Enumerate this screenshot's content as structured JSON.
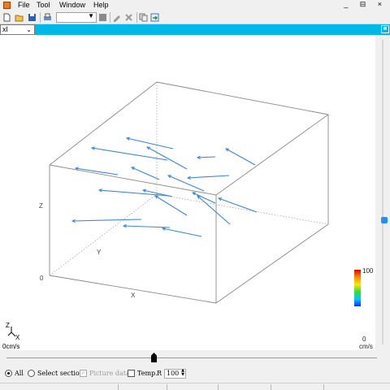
{
  "menu": {
    "items": [
      "File",
      "Tool",
      "Window",
      "Help"
    ]
  },
  "toolbar": {
    "combo_value": ""
  },
  "document": {
    "selector_value": "xl"
  },
  "window_controls": "_ ⊟ ×",
  "scene": {
    "axis_labels": {
      "x": "X",
      "y": "Y",
      "z": "Z",
      "zero": "0"
    },
    "triad_labels": {
      "z": "Z",
      "x": "X"
    },
    "speed_unit_label": "0cm/s",
    "legend": {
      "max": "100",
      "min": "0",
      "unit": "cm/s"
    },
    "vector_color": "#3a86d8",
    "box_color": "#8a8a8a"
  },
  "controls": {
    "all_label": "All",
    "select_section_label": "Select section",
    "picture_data_label": "Picture data",
    "temp_label": "Temp.",
    "r_label": "R",
    "r_value": "100"
  }
}
